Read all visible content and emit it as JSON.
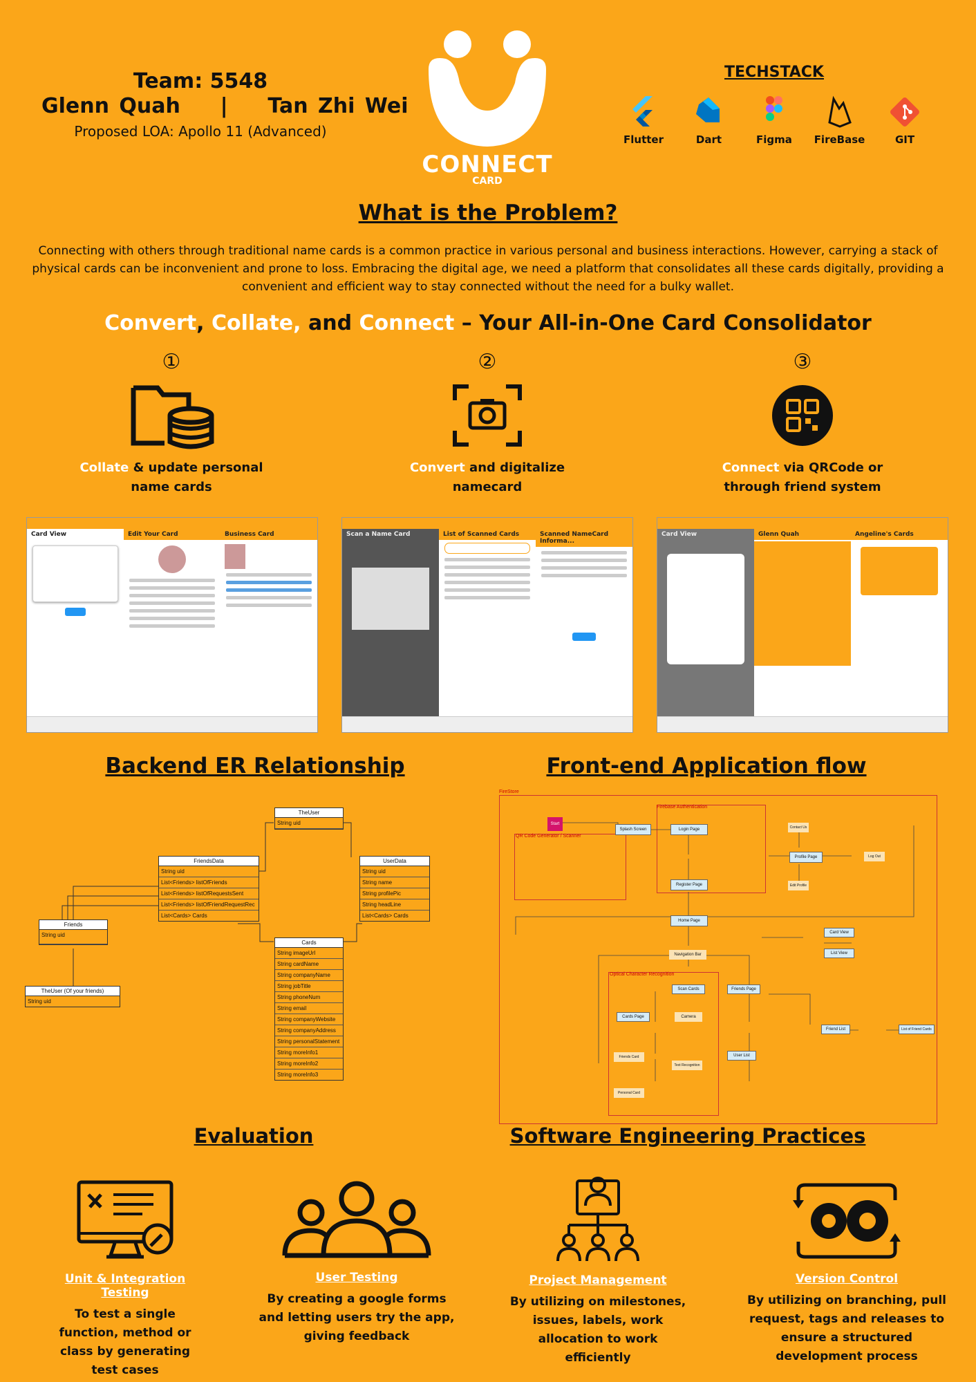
{
  "header": {
    "team": "Team: 5548",
    "members": "Glenn Quah    |    Tan Zhi Wei",
    "loa": "Proposed LOA: Apollo 11 (Advanced)"
  },
  "logo": {
    "name": "CONNECT",
    "sub": "CARD"
  },
  "techstack": {
    "title": "TECHSTACK",
    "items": [
      {
        "label": "Flutter",
        "icon": "flutter-icon"
      },
      {
        "label": "Dart",
        "icon": "dart-icon"
      },
      {
        "label": "Figma",
        "icon": "figma-icon"
      },
      {
        "label": "FireBase",
        "icon": "firebase-icon"
      },
      {
        "label": "GIT",
        "icon": "git-icon"
      }
    ]
  },
  "problem": {
    "title": "What is the Problem?",
    "text": "Connecting with others through traditional name cards is a common practice in various personal and business interactions. However, carrying a stack of physical cards can be inconvenient and prone to loss. Embracing the digital age, we need a platform that consolidates all these cards digitally, providing a convenient and efficient way to stay connected without the need for a bulky wallet."
  },
  "tagline": {
    "w1": "Convert",
    "c1": ", ",
    "w2": "Collate,",
    "c2": " and ",
    "w3": "Connect",
    "rest": " – Your All-in-One Card Consolidator"
  },
  "features": [
    {
      "num": "①",
      "hl": "Collate",
      "text": " & update personal name cards",
      "icon": "folder-database-icon"
    },
    {
      "num": "②",
      "hl": "Convert",
      "text": " and digitalize namecard",
      "icon": "camera-scan-icon"
    },
    {
      "num": "③",
      "hl": "Connect",
      "text": " via QRCode or through friend system",
      "icon": "qr-code-icon"
    }
  ],
  "screens": {
    "s1": [
      "Card View",
      "Edit Your Card",
      "Business Card"
    ],
    "s2": [
      "Scan a Name Card",
      "List of Scanned Cards",
      "Scanned NameCard Informa..."
    ],
    "s3": [
      "Card View",
      "Glenn Quah",
      "Angeline's Cards"
    ]
  },
  "er": {
    "title": "Backend ER Relationship",
    "entities": {
      "theuser": {
        "name": "TheUser",
        "fields": [
          "String uid"
        ]
      },
      "friendsdata": {
        "name": "FriendsData",
        "fields": [
          "String uid",
          "List<Friends> listOfFriends",
          "List<Friends> listOfRequestsSent",
          "List<Friends> listOfFriendRequestRec",
          "List<Cards> Cards"
        ]
      },
      "userdata": {
        "name": "UserData",
        "fields": [
          "String uid",
          "String name",
          "String profilePic",
          "String headLine",
          "List<Cards> Cards"
        ]
      },
      "friends": {
        "name": "Friends",
        "fields": [
          "String uid"
        ]
      },
      "theuserfriends": {
        "name": "TheUser (Of your friends)",
        "fields": [
          "String uid"
        ]
      },
      "cards": {
        "name": "Cards",
        "fields": [
          "String imageUrl",
          "String cardName",
          "String companyName",
          "String jobTitle",
          "String phoneNum",
          "String email",
          "String companyWebsite",
          "String companyAddress",
          "String personalStatement",
          "String moreInfo1",
          "String moreInfo2",
          "String moreInfo3"
        ]
      }
    }
  },
  "flow": {
    "title": "Front-end Application flow",
    "sections": [
      "FireStore",
      "Firebase Authentication",
      "QR Code Generator / Scanner",
      "Optical Character Recognition"
    ],
    "nodes": [
      "Start",
      "Splash Screen",
      "Login Page",
      "Register Page",
      "Home Page",
      "Profile Page",
      "Edit Profile",
      "Contact Us",
      "Log Out",
      "Card View",
      "List View",
      "Navigation Bar",
      "Scan Cards",
      "Friends Page",
      "Cards Page",
      "Camera",
      "Text Recognition",
      "Friend List",
      "List of Friend Cards",
      "User List",
      "Personal Card",
      "Friends Card"
    ]
  },
  "evaluation": {
    "title": "Evaluation"
  },
  "sep": {
    "title": "Software Engineering Practices"
  },
  "practices": [
    {
      "title": "Unit & Integration Testing",
      "desc": "To test a single function, method or class by generating test cases",
      "icon": "monitor-tools-icon"
    },
    {
      "title": "User Testing",
      "desc": "By creating a google forms and letting users try the app, giving feedback",
      "icon": "users-group-icon"
    },
    {
      "title": "Project Management",
      "desc": "By utilizing on milestones, issues, labels, work allocation to work efficiently",
      "icon": "team-hierarchy-icon"
    },
    {
      "title": "Version Control",
      "desc": "By utilizing on branching, pull request, tags and releases to ensure a structured development process",
      "icon": "gears-cycle-icon"
    }
  ]
}
